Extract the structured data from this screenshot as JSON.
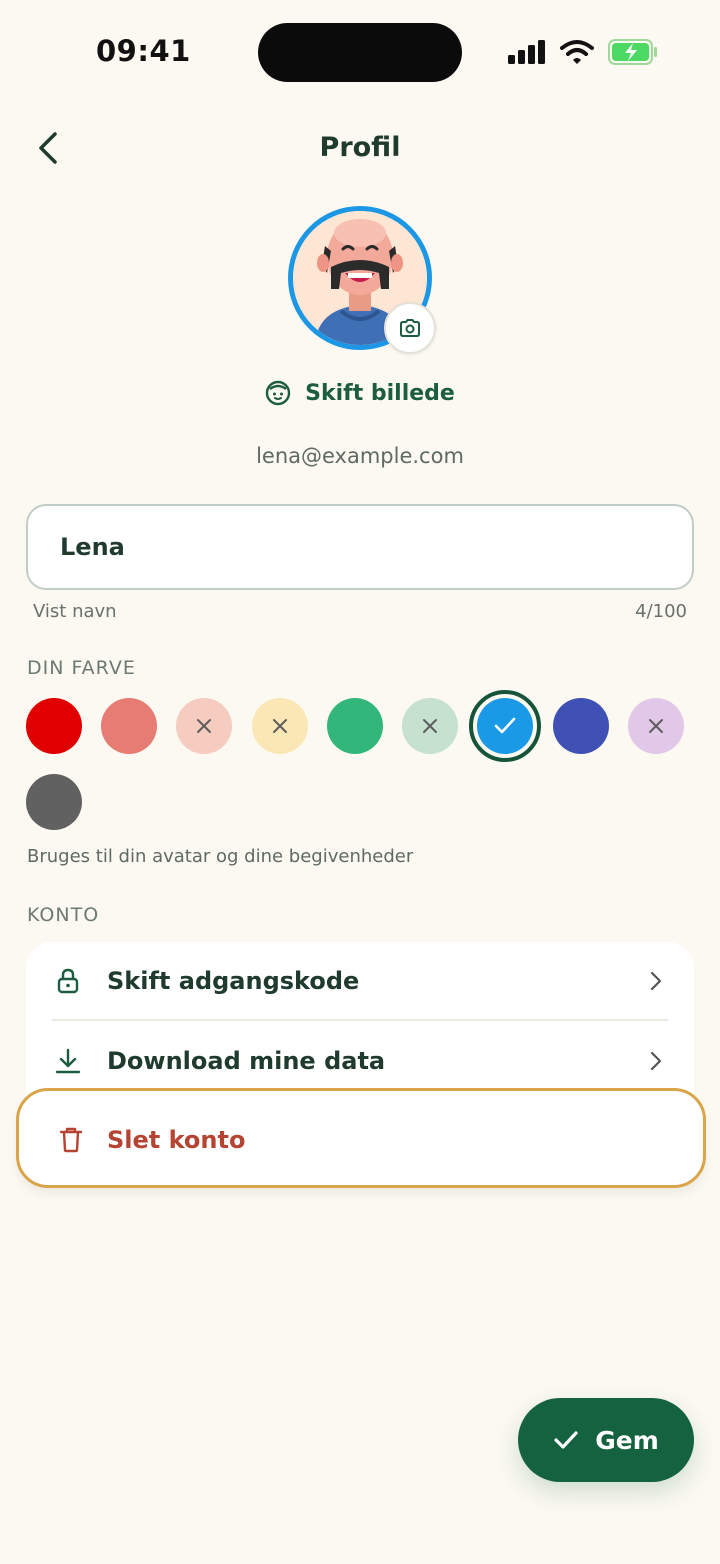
{
  "status_bar": {
    "time": "09:41"
  },
  "header": {
    "title": "Profil"
  },
  "profile": {
    "change_photo_label": "Skift billede",
    "email": "lena@example.com"
  },
  "name_field": {
    "value": "Lena",
    "helper": "Vist navn",
    "counter": "4/100"
  },
  "colors": {
    "label": "DIN FARVE",
    "hint": "Bruges til din avatar og dine begivenheder",
    "swatches": [
      {
        "color": "#e00000",
        "state": "available"
      },
      {
        "color": "#e67c73",
        "state": "available"
      },
      {
        "color": "#f7ccc0",
        "state": "unavailable"
      },
      {
        "color": "#fbe7b5",
        "state": "unavailable"
      },
      {
        "color": "#33b679",
        "state": "available"
      },
      {
        "color": "#c6e1cf",
        "state": "unavailable"
      },
      {
        "color": "#1a9ae6",
        "state": "selected"
      },
      {
        "color": "#3f51b5",
        "state": "available"
      },
      {
        "color": "#e2c8e8",
        "state": "unavailable"
      },
      {
        "color": "#616161",
        "state": "available"
      }
    ]
  },
  "account": {
    "label": "KONTO",
    "items": [
      {
        "label": "Skift adgangskode",
        "icon": "lock-icon"
      },
      {
        "label": "Download mine data",
        "icon": "download-icon"
      },
      {
        "label": "Slet konto",
        "icon": "trash-icon"
      }
    ]
  },
  "save_button": {
    "label": "Gem"
  },
  "theme": {
    "primary": "#14623f",
    "danger": "#b64433",
    "highlight": "#d9a548"
  }
}
